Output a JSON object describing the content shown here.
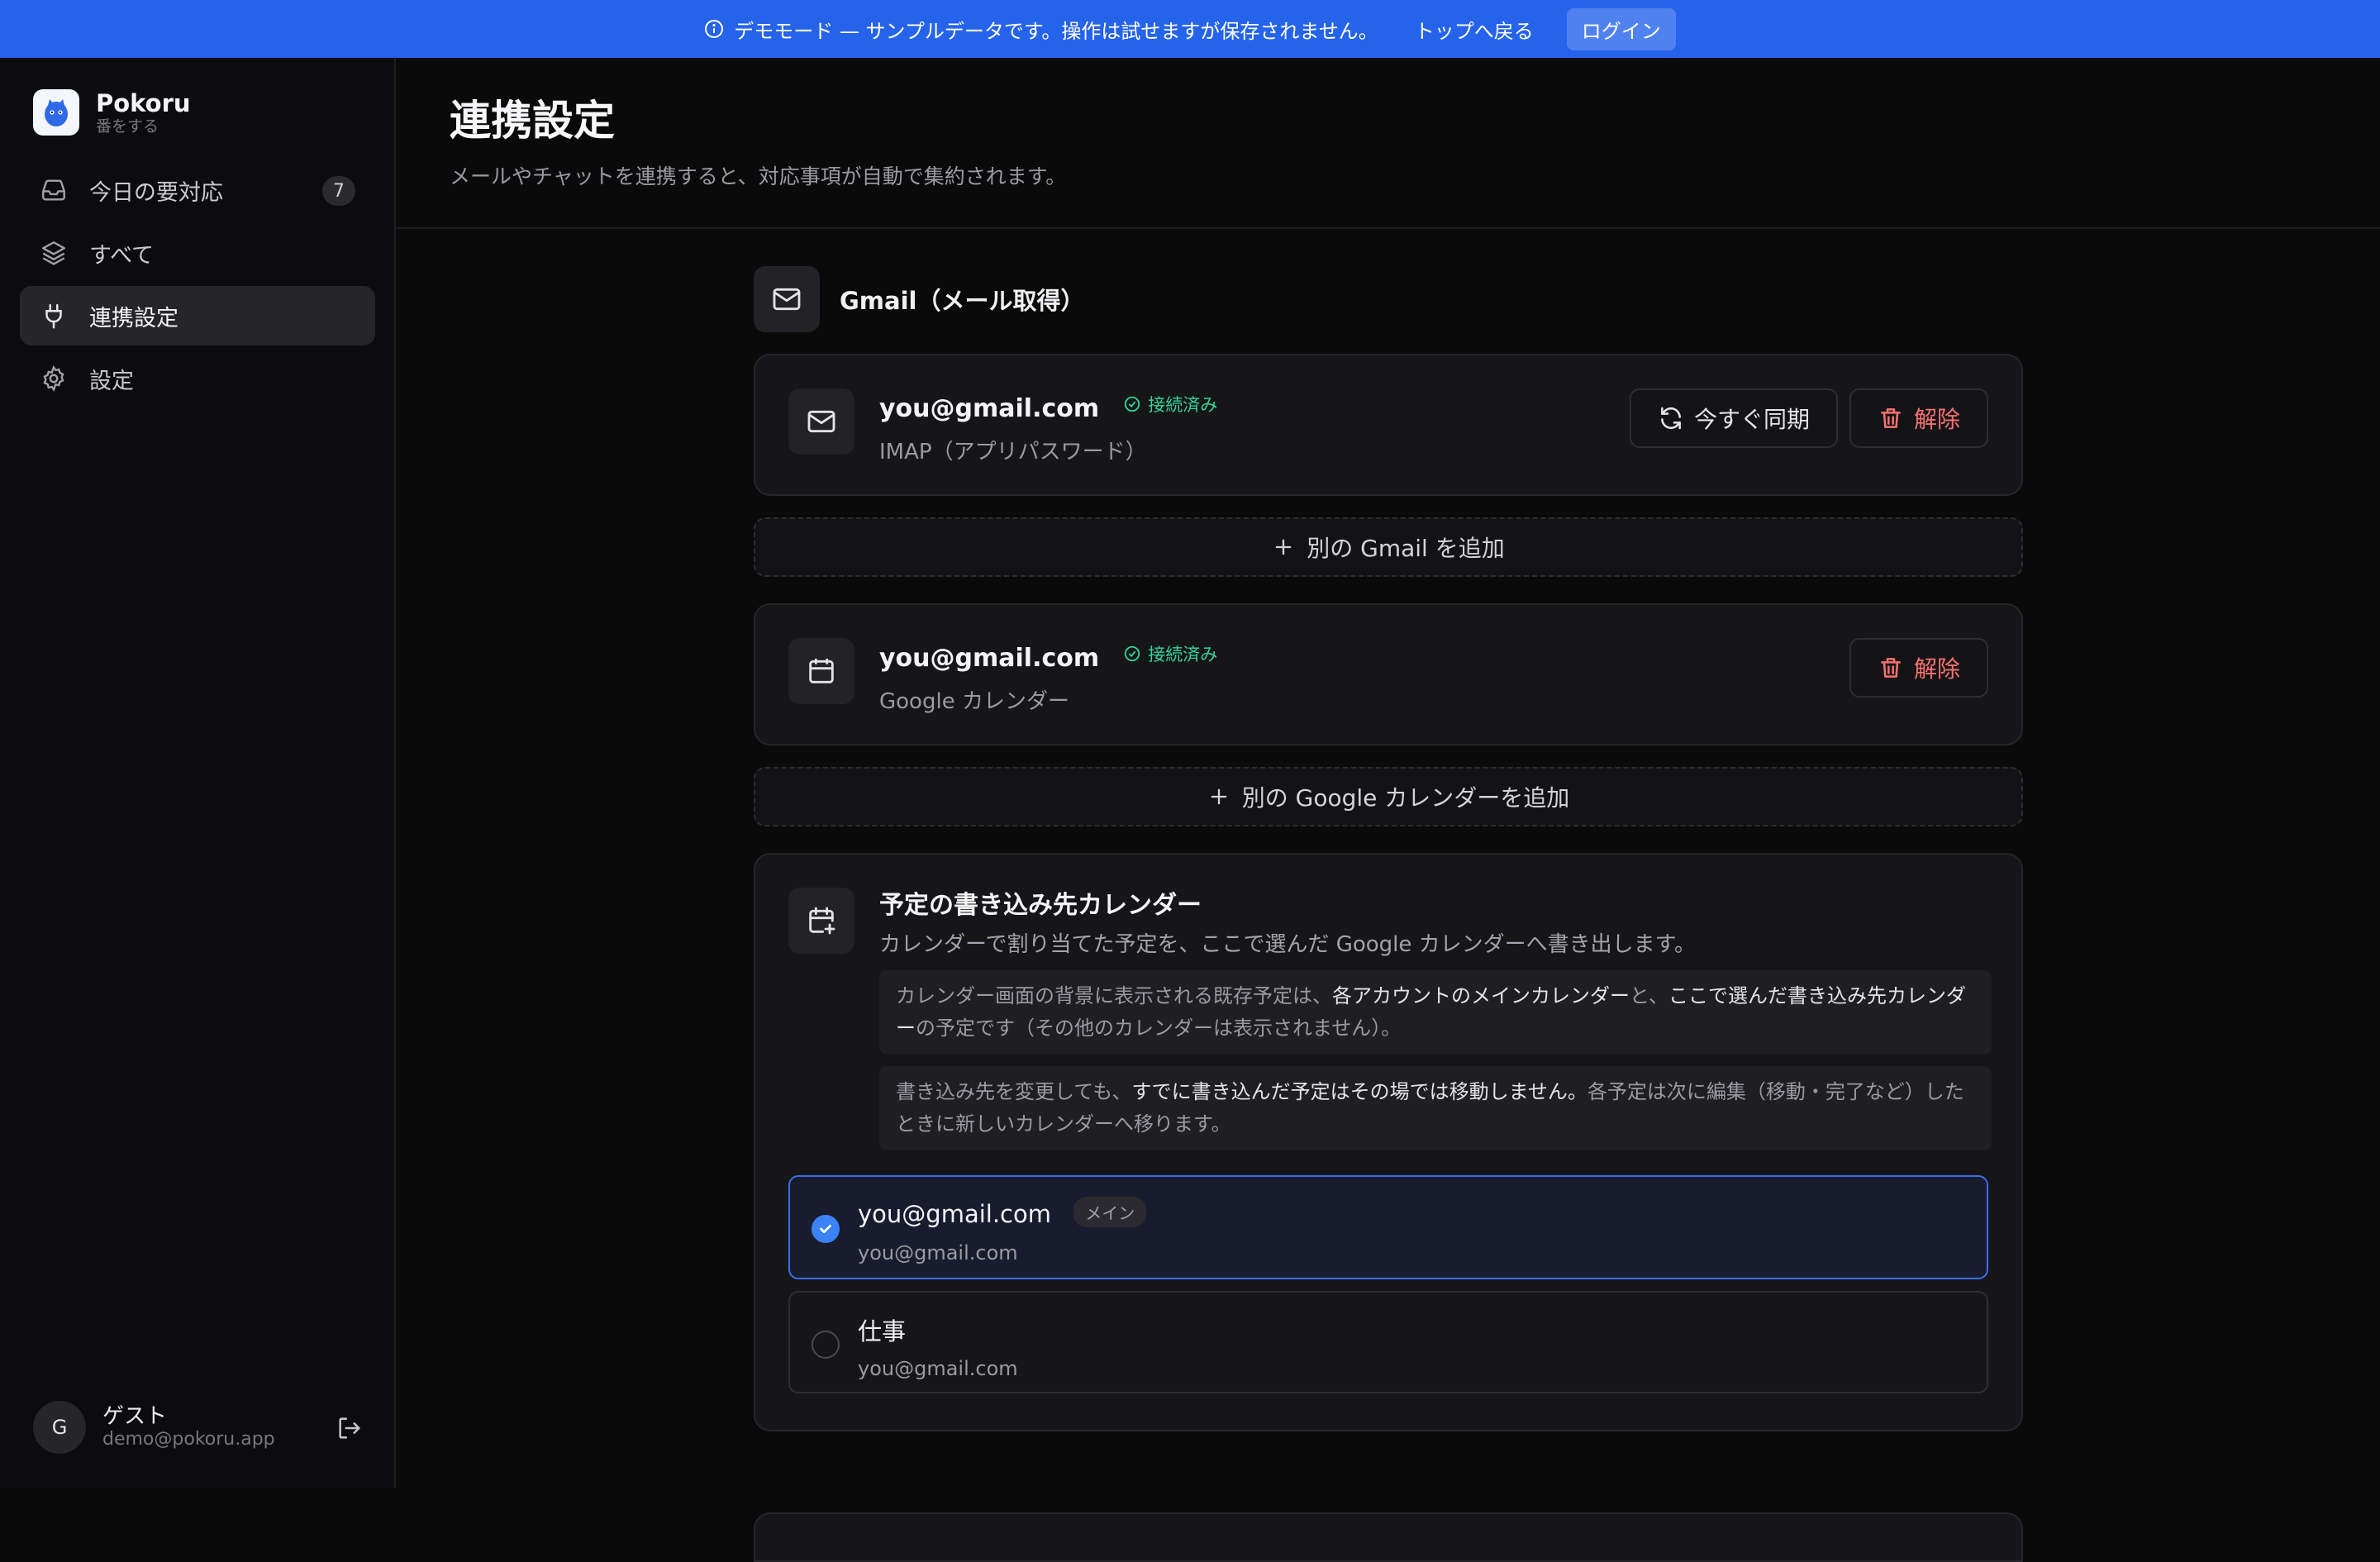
{
  "banner": {
    "message": "デモモード — サンプルデータです。操作は試せますが保存されません。",
    "back_link": "トップへ戻る",
    "login": "ログイン"
  },
  "sidebar": {
    "app_name": "Pokoru",
    "app_sub": "番をする",
    "items": [
      {
        "label": "今日の要対応",
        "badge": "7",
        "icon": "inbox-icon"
      },
      {
        "label": "すべて",
        "icon": "layers-icon"
      },
      {
        "label": "連携設定",
        "icon": "plug-icon",
        "active": true
      },
      {
        "label": "設定",
        "icon": "gear-icon"
      }
    ],
    "user": {
      "initial": "G",
      "name": "ゲスト",
      "email": "demo@pokoru.app"
    }
  },
  "page": {
    "title": "連携設定",
    "subtitle": "メールやチャットを連携すると、対応事項が自動で集約されます。"
  },
  "gmail_section": {
    "title": "Gmail（メール取得）",
    "account": {
      "email": "you@gmail.com",
      "status": "接続済み",
      "type": "IMAP（アプリパスワード）",
      "sync_label": "今すぐ同期",
      "remove_label": "解除"
    },
    "add_label": "別の Gmail を追加"
  },
  "calendar_section": {
    "account": {
      "email": "you@gmail.com",
      "status": "接続済み",
      "type": "Google カレンダー",
      "remove_label": "解除"
    },
    "add_label": "別の Google カレンダーを追加"
  },
  "target_calendar": {
    "title": "予定の書き込み先カレンダー",
    "subtitle": "カレンダーで割り当てた予定を、ここで選んだ Google カレンダーへ書き出します。",
    "note1": {
      "a": "カレンダー画面の背景に表示される既存予定は、",
      "b": "各アカウントのメインカレンダー",
      "c": "と、",
      "d": "ここで選んだ書き込み先カレンダー",
      "e": "の予定です（その他のカレンダーは表示されません）。"
    },
    "note2": {
      "a": "書き込み先を変更しても、",
      "b": "すでに書き込んだ予定はその場では移動しません。",
      "c": "各予定は次に編集（移動・完了など）したときに新しいカレンダーへ移ります。"
    },
    "options": [
      {
        "name": "you@gmail.com",
        "tag": "メイン",
        "account": "you@gmail.com",
        "selected": true
      },
      {
        "name": "仕事",
        "account": "you@gmail.com",
        "selected": false
      }
    ]
  },
  "colors": {
    "accent": "#2563eb",
    "connected": "#34d399",
    "danger": "#f87171"
  }
}
